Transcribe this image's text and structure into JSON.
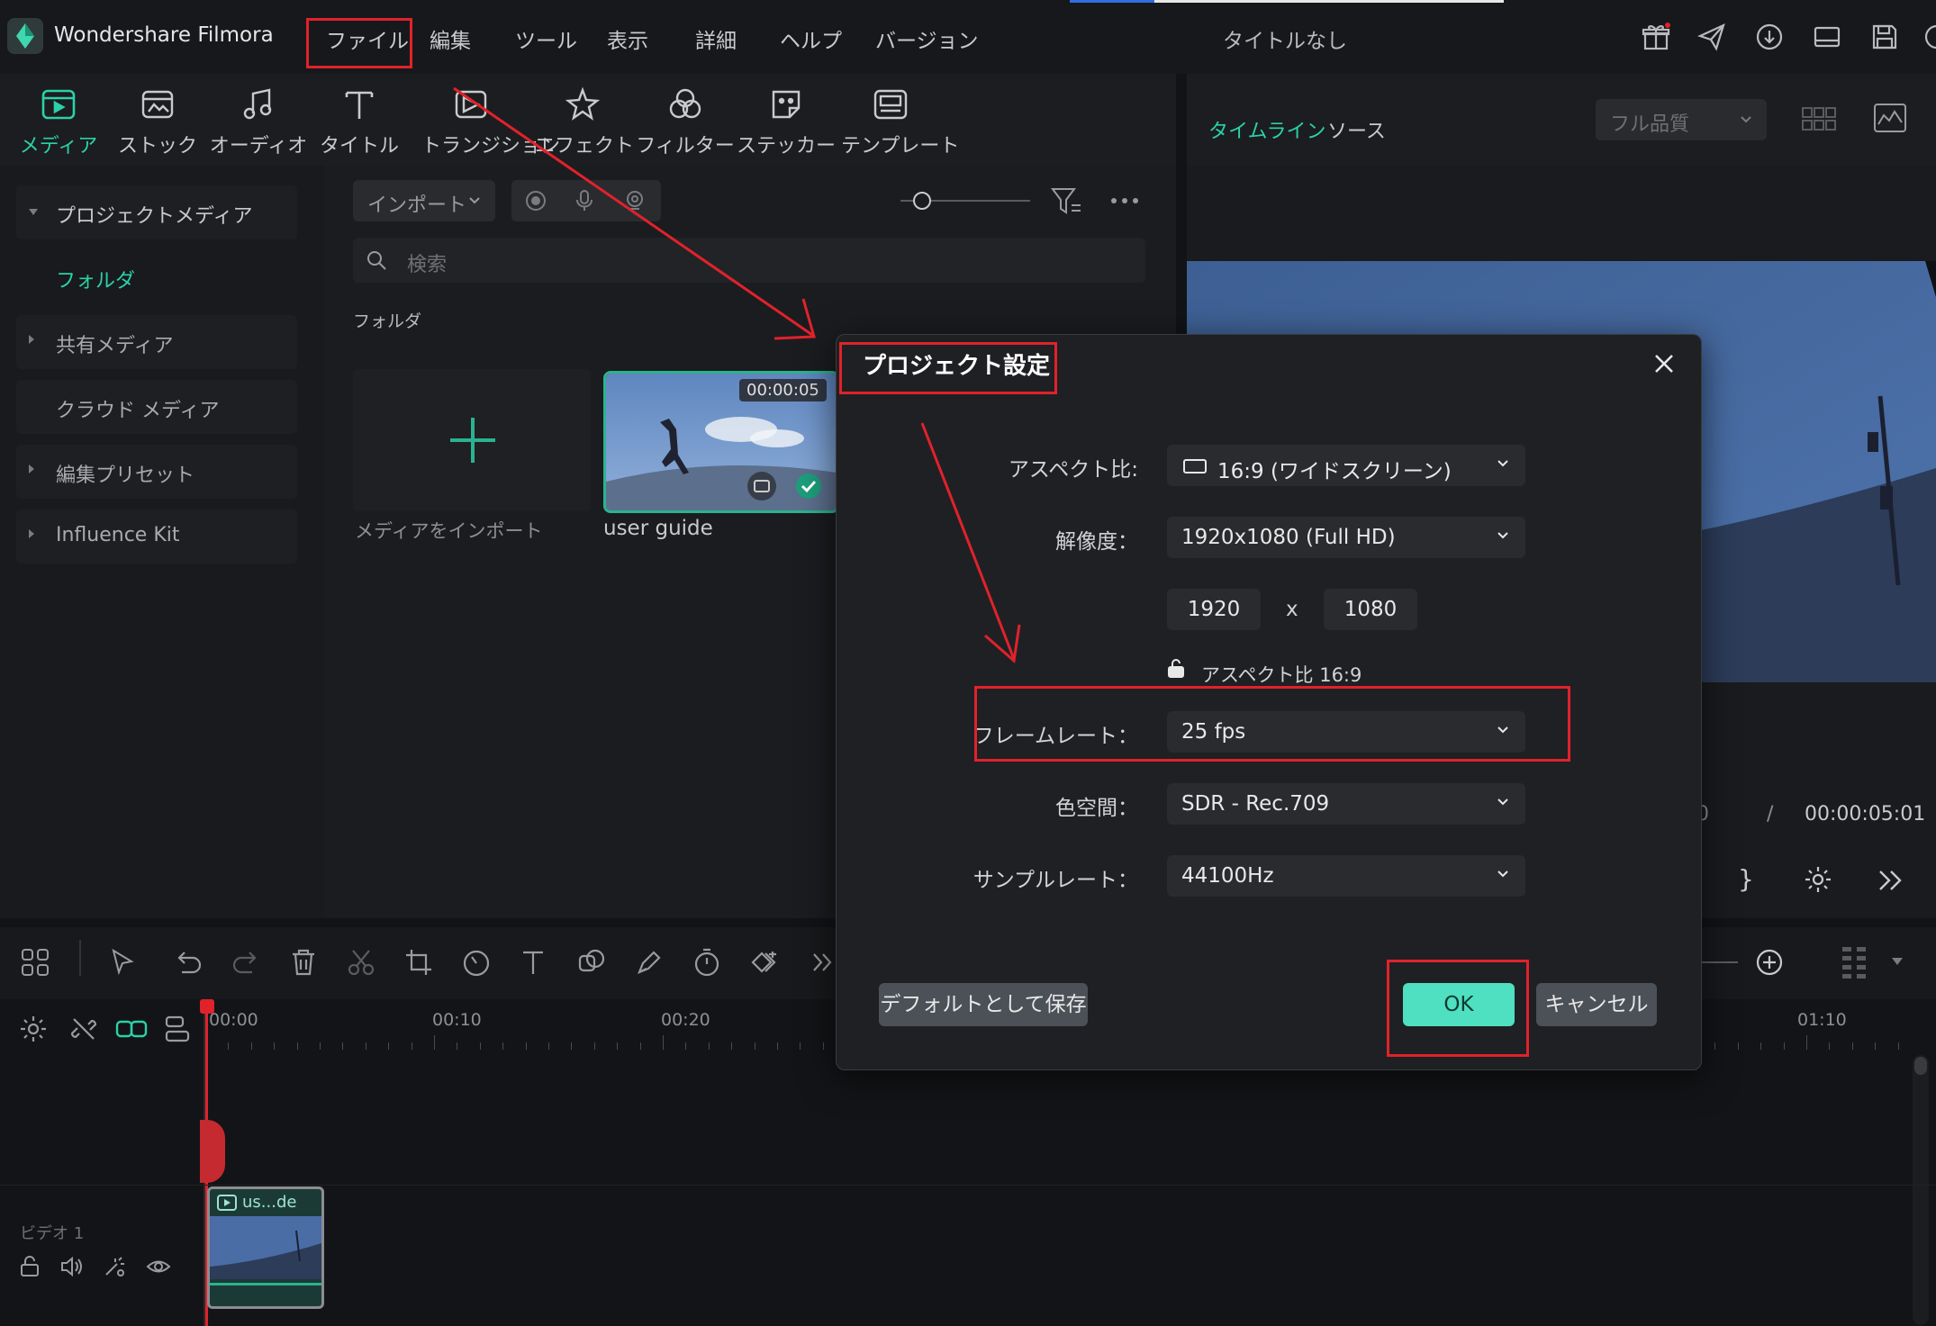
{
  "app": {
    "name": "Wondershare Filmora",
    "document_title": "タイトルなし"
  },
  "menu": [
    "ファイル",
    "編集",
    "ツール",
    "表示",
    "詳細",
    "ヘルプ",
    "バージョン"
  ],
  "toolbar": [
    "メディア",
    "ストック",
    "オーディオ",
    "タイトル",
    "トランジション",
    "エフェクト",
    "フィルター",
    "ステッカー",
    "テンプレート"
  ],
  "sidebar": {
    "items": [
      {
        "label": "プロジェクトメディア"
      },
      {
        "label": "フォルダ"
      },
      {
        "label": "共有メディア"
      },
      {
        "label": "クラウド メディア"
      },
      {
        "label": "編集プリセット"
      },
      {
        "label": "Influence Kit"
      }
    ]
  },
  "media": {
    "import_label": "インポート",
    "search_placeholder": "検索",
    "folder_heading": "フォルダ",
    "import_tile_label": "メディアをインポート",
    "clip": {
      "name": "user guide",
      "duration": "00:00:05"
    }
  },
  "preview": {
    "tabs": [
      "タイムライン",
      "ソース"
    ],
    "quality": "フル品質",
    "time_current": "0",
    "time_separator": "/",
    "time_total": "00:00:05:01"
  },
  "timeline": {
    "ruler": [
      "00:00",
      "00:10",
      "00:20",
      "01:10"
    ],
    "track_label": "ビデオ 1",
    "clip_label": "us...de"
  },
  "dialog": {
    "title": "プロジェクト設定",
    "aspect_label": "アスペクト比:",
    "aspect_value": "16:9 (ワイドスクリーン)",
    "resolution_label": "解像度：",
    "resolution_value": "1920x1080 (Full HD)",
    "width": "1920",
    "times": "x",
    "height": "1080",
    "aspect_lock_text": "アスペクト比 16:9",
    "framerate_label": "フレームレート：",
    "framerate_value": "25 fps",
    "colorspace_label": "色空間：",
    "colorspace_value": "SDR - Rec.709",
    "samplerate_label": "サンプルレート：",
    "samplerate_value": "44100Hz",
    "save_default": "デフォルトとして保存",
    "ok": "OK",
    "cancel": "キャンセル"
  },
  "colors": {
    "accent": "#2bd1a8",
    "ok_button": "#4ee0c0",
    "annotation": "#e0222b"
  }
}
